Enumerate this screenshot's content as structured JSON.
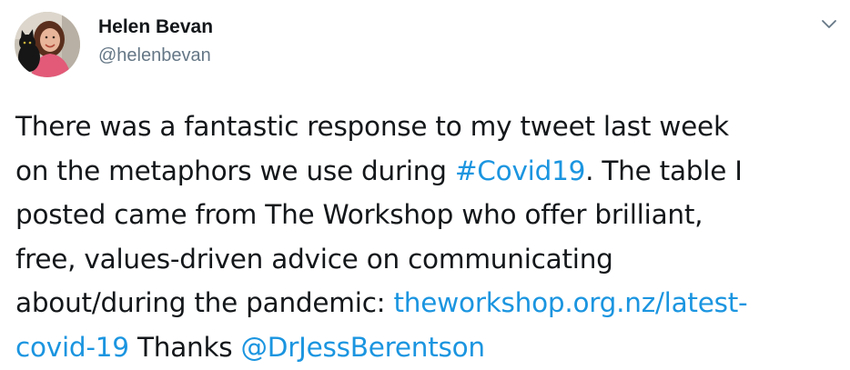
{
  "author": {
    "name": "Helen Bevan",
    "handle": "@helenbevan"
  },
  "tweet": {
    "line1": "There was a fantastic response to my tweet last week",
    "line2_pre": "on the metaphors we use during ",
    "hashtag": "#Covid19",
    "line2_post": ". The table I",
    "line3": "posted came from The Workshop who offer brilliant,",
    "line4": "free, values-driven advice on communicating",
    "line5_pre": "about/during the pandemic: ",
    "link_part1": "theworkshop.org.nz/latest-",
    "link_part2": "covid-19",
    "line6_mid": " Thanks ",
    "mention": "@DrJessBerentson"
  },
  "icons": {
    "avatar": "profile-photo",
    "menu": "chevron-down-icon"
  },
  "colors": {
    "link": "#1b95e0",
    "text": "#14171a",
    "secondary": "#657786"
  }
}
